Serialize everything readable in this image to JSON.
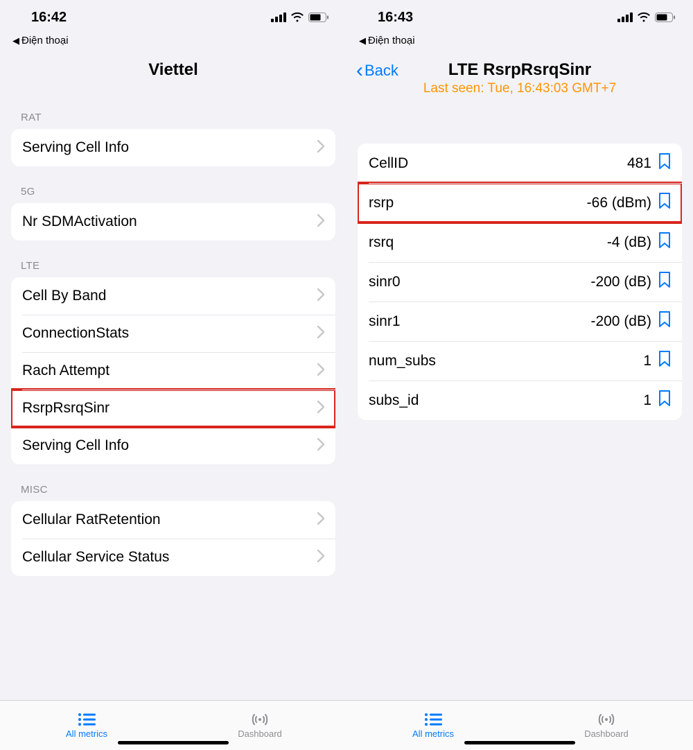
{
  "left": {
    "status": {
      "time": "16:42",
      "breadcrumb": "Điện thoại"
    },
    "title": "Viettel",
    "sections": [
      {
        "header": "RAT",
        "items": [
          {
            "label": "Serving Cell Info"
          }
        ]
      },
      {
        "header": "5G",
        "items": [
          {
            "label": "Nr SDMActivation"
          }
        ]
      },
      {
        "header": "LTE",
        "items": [
          {
            "label": "Cell By Band"
          },
          {
            "label": "ConnectionStats"
          },
          {
            "label": "Rach Attempt"
          },
          {
            "label": "RsrpRsrqSinr",
            "highlight": true
          },
          {
            "label": "Serving Cell Info"
          }
        ]
      },
      {
        "header": "MISC",
        "items": [
          {
            "label": "Cellular RatRetention"
          },
          {
            "label": "Cellular Service Status"
          }
        ]
      }
    ]
  },
  "right": {
    "status": {
      "time": "16:43",
      "breadcrumb": "Điện thoại"
    },
    "back": "Back",
    "title": "LTE RsrpRsrqSinr",
    "subtitle": "Last seen: Tue, 16:43:03 GMT+7",
    "metrics": [
      {
        "label": "CellID",
        "value": "481"
      },
      {
        "label": "rsrp",
        "value": "-66 (dBm)",
        "highlight": true
      },
      {
        "label": "rsrq",
        "value": "-4 (dB)"
      },
      {
        "label": "sinr0",
        "value": "-200 (dB)"
      },
      {
        "label": "sinr1",
        "value": "-200 (dB)"
      },
      {
        "label": "num_subs",
        "value": "1"
      },
      {
        "label": "subs_id",
        "value": "1"
      }
    ]
  },
  "tabs": {
    "metrics": "All metrics",
    "dashboard": "Dashboard"
  }
}
